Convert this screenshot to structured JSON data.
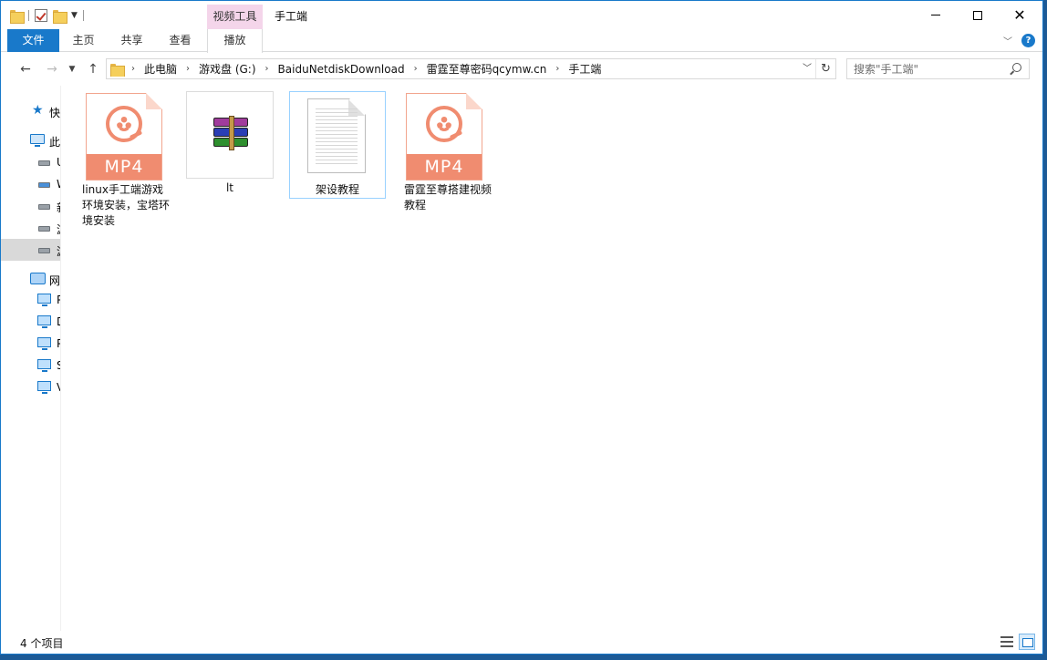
{
  "window": {
    "title": "手工端",
    "context_tab_group": "视频工具"
  },
  "ribbon": {
    "tabs": [
      "文件",
      "主页",
      "共享",
      "查看",
      "播放"
    ]
  },
  "navigation": {
    "breadcrumbs": [
      "此电脑",
      "游戏盘 (G:)",
      "BaiduNetdiskDownload",
      "雷霆至尊密码qcymw.cn",
      "手工端"
    ],
    "search_placeholder": "搜索\"手工端\""
  },
  "nav_pane": {
    "items": [
      {
        "label": "快",
        "icon": "star-icon"
      },
      {
        "label": "此",
        "icon": "this-pc-icon"
      },
      {
        "label": "U",
        "icon": "drive-icon"
      },
      {
        "label": "W",
        "icon": "network-drive-icon"
      },
      {
        "label": "新",
        "icon": "drive-icon"
      },
      {
        "label": "游",
        "icon": "drive-icon"
      },
      {
        "label": "游",
        "icon": "drive-icon",
        "selected": true
      },
      {
        "label": "网",
        "icon": "network-icon"
      },
      {
        "label": "P",
        "icon": "computer-icon"
      },
      {
        "label": "D",
        "icon": "computer-icon"
      },
      {
        "label": "P",
        "icon": "computer-icon"
      },
      {
        "label": "S",
        "icon": "computer-icon"
      },
      {
        "label": "V",
        "icon": "computer-icon"
      }
    ]
  },
  "files": [
    {
      "name": "linux手工端游戏环境安装，宝塔环境安装",
      "type": "mp4",
      "badge": "MP4"
    },
    {
      "name": "lt",
      "type": "rar",
      "badge": ""
    },
    {
      "name": "架设教程",
      "type": "txt",
      "badge": "",
      "selected": true
    },
    {
      "name": "雷霆至尊搭建视频教程",
      "type": "mp4",
      "badge": "MP4"
    }
  ],
  "status": {
    "item_count": "4 个项目"
  },
  "colors": {
    "accent": "#1979ca",
    "context_tab": "#f4d5ea",
    "mp4_badge": "#f08c70",
    "selected_nav": "#d9d9d9"
  }
}
